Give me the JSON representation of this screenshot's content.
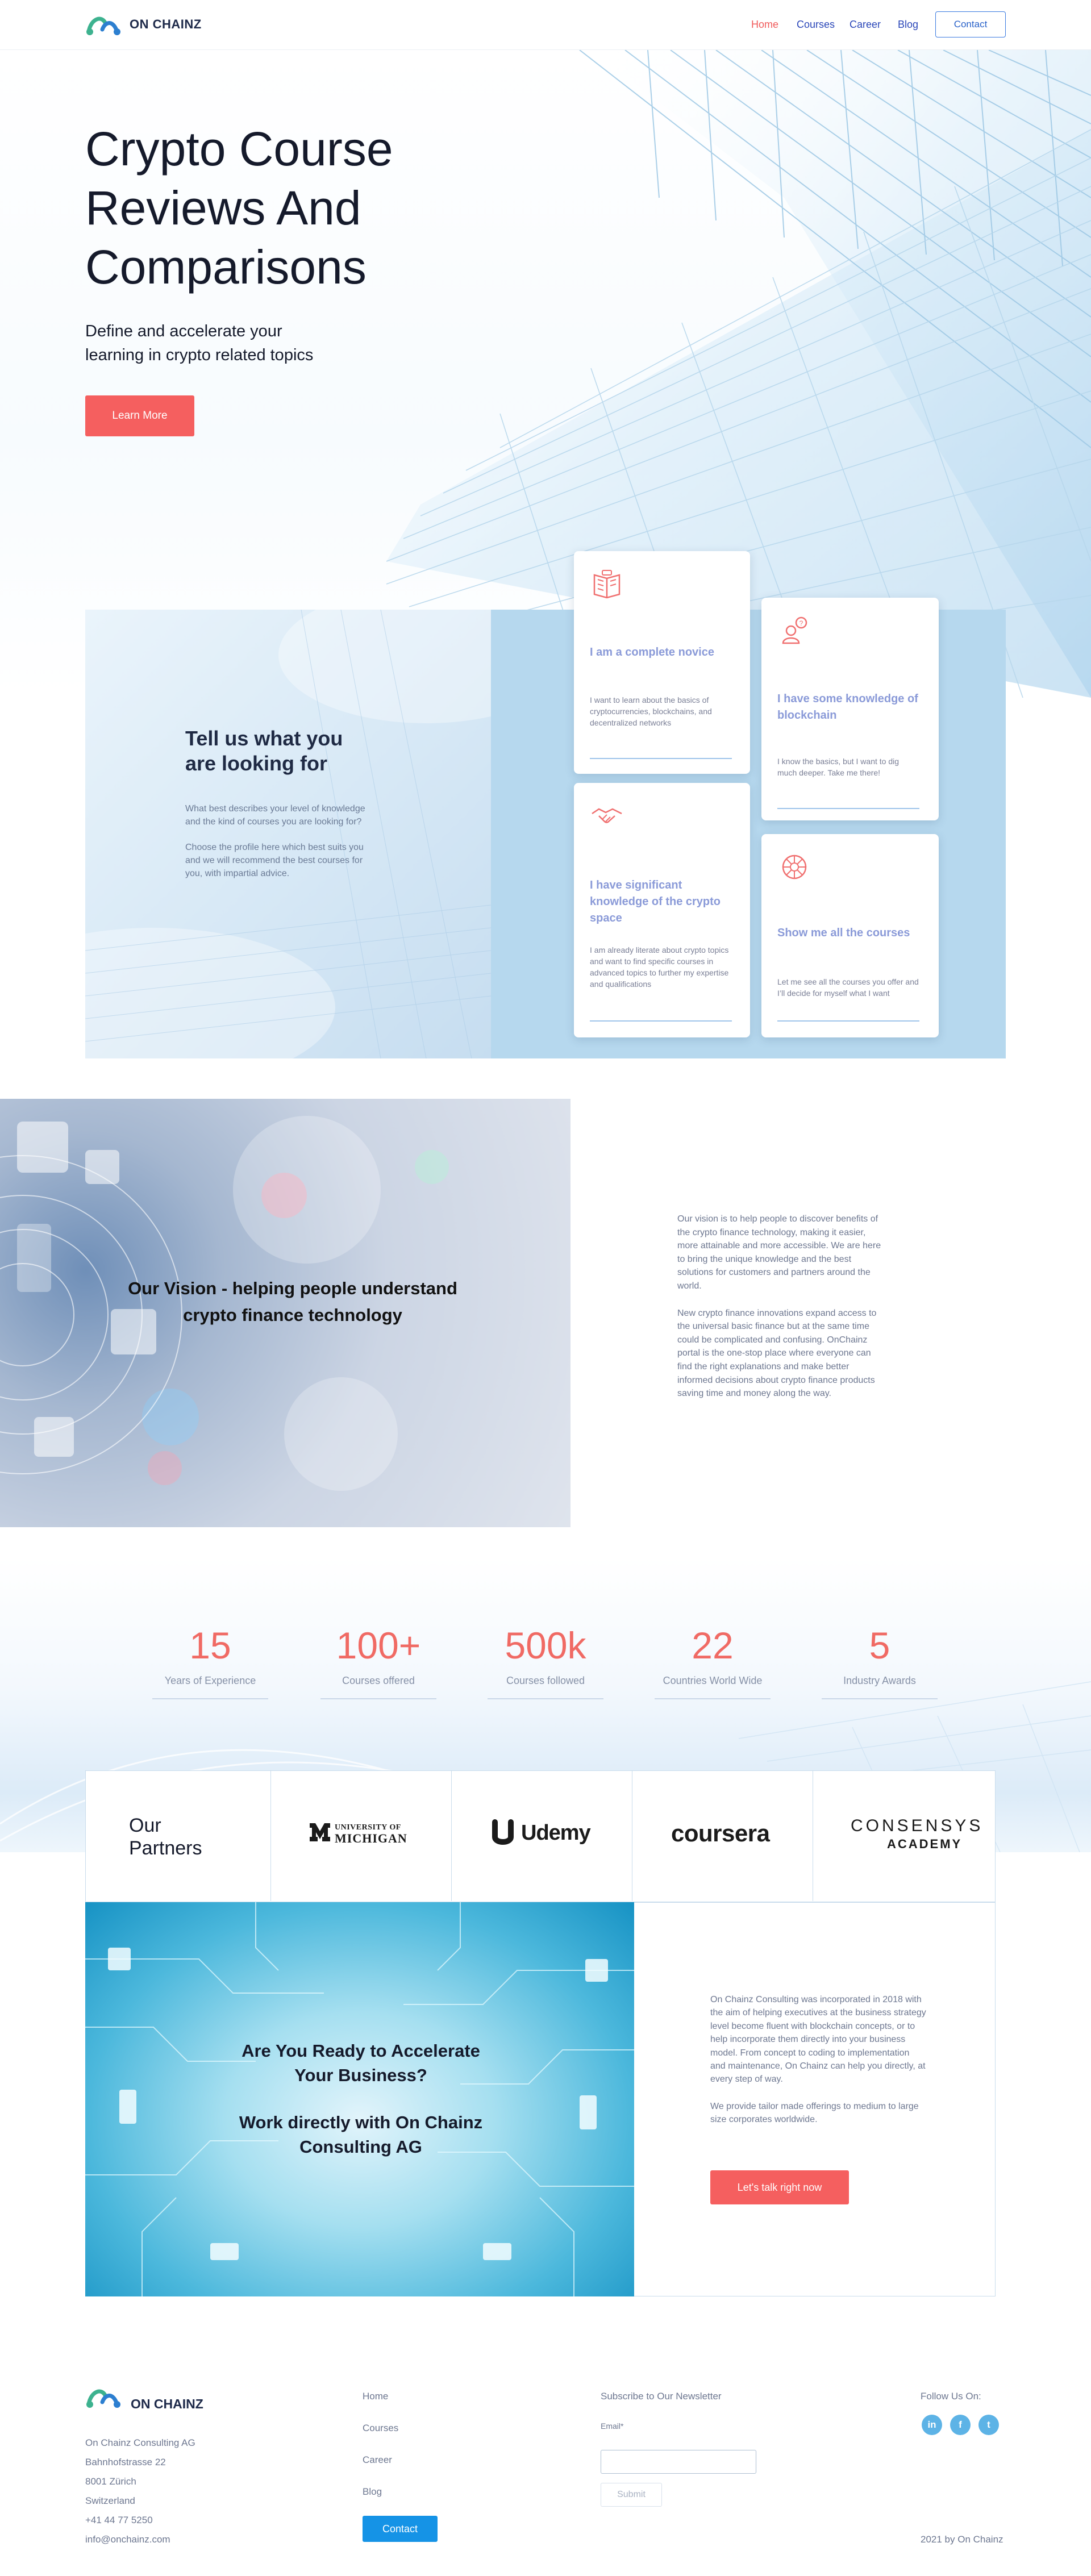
{
  "nav": {
    "brand": "ON CHAINZ",
    "links": [
      "Home",
      "Courses",
      "Career",
      "Blog"
    ],
    "contact": "Contact"
  },
  "hero": {
    "title_lines": [
      "Crypto Course",
      "Reviews And",
      "Comparisons"
    ],
    "subtitle_lines": [
      "Define and accelerate your",
      "learning in crypto related topics"
    ],
    "button": "Learn More"
  },
  "profiles": {
    "title_lines": [
      "Tell us what you",
      "are looking for"
    ],
    "p1": "What best describes your level of knowledge and the kind of courses you are looking for?",
    "p2": "Choose the profile here which best suits you and we will recommend the best courses for you, with impartial advice.",
    "cards": [
      {
        "icon": "book-icon",
        "title": "I am a complete novice",
        "text": "I want to learn about the basics of cryptocurrencies, blockchains, and decentralized networks"
      },
      {
        "icon": "person-question-icon",
        "title": "I have some knowledge of blockchain",
        "text": "I know the basics, but I want to dig much deeper. Take me there!"
      },
      {
        "icon": "handshake-icon",
        "title": "I have significant knowledge of the crypto space",
        "text": "I am already literate about crypto topics and want to find specific courses in advanced topics to further my expertise and qualifications"
      },
      {
        "icon": "network-icon",
        "title": "Show me all the courses",
        "text": "Let me see all the courses you offer and I’ll decide for myself what I want"
      }
    ]
  },
  "vision": {
    "title_lines": [
      "Our Vision - helping people understand",
      "crypto finance technology"
    ],
    "p1": "Our vision is to help people to discover benefits of the crypto finance technology, making it easier, more attainable and more accessible. We are here to bring the unique knowledge and the best solutions for customers and partners around the world.",
    "p2": "New crypto finance innovations expand access to the universal basic finance but at the same time could be complicated and confusing. OnChainz portal is the one-stop place where everyone can find the right explanations and make better informed decisions about crypto finance products saving time and money along the way."
  },
  "stats": [
    {
      "value": "15",
      "label": "Years of Experience"
    },
    {
      "value": "100+",
      "label": "Courses offered"
    },
    {
      "value": "500k",
      "label": "Courses followed"
    },
    {
      "value": "22",
      "label": "Countries World Wide"
    },
    {
      "value": "5",
      "label": "Industry Awards"
    }
  ],
  "partners": {
    "title_lines": [
      "Our",
      "Partners"
    ],
    "logos": [
      {
        "top": "UNIVERSITY OF",
        "bottom": "MICHIGAN"
      },
      {
        "name": "Udemy"
      },
      {
        "name": "coursera"
      },
      {
        "top": "CONSENSYS",
        "bottom": "ACADEMY"
      }
    ]
  },
  "consult": {
    "title_lines": [
      "Are You Ready to Accelerate",
      "Your Business?"
    ],
    "title2_lines": [
      "Work directly with On Chainz",
      "Consulting AG"
    ],
    "p1": "On Chainz Consulting was incorporated in 2018 with the aim of helping executives at the business strategy level become fluent with blockchain concepts, or to help incorporate them directly into your business model. From concept to coding to implementation and maintenance, On Chainz can help you directly, at every step of way.",
    "p2": "We provide tailor made offerings to medium to large size corporates worldwide.",
    "button": "Let's talk right now"
  },
  "footer": {
    "brand": "ON CHAINZ",
    "address": [
      "On Chainz Consulting AG",
      "Bahnhofstrasse 22",
      "8001 Zürich",
      "Switzerland",
      "+41 44 77 5250",
      "info@onchainz.com"
    ],
    "links": [
      "Home",
      "Courses",
      "Career",
      "Blog"
    ],
    "contact": "Contact",
    "newsletter_title": "Subscribe to Our Newsletter",
    "email_label": "Email*",
    "email_value": "",
    "submit": "Submit",
    "follow_title": "Follow Us On:",
    "social": [
      {
        "icon": "linkedin-icon",
        "glyph": "in"
      },
      {
        "icon": "facebook-icon",
        "glyph": "f"
      },
      {
        "icon": "twitter-icon",
        "glyph": "t"
      }
    ],
    "copyright": "2021 by On Chainz"
  },
  "colors": {
    "accent": "#f55f5f",
    "brand_blue": "#2a46b8",
    "card_title": "#8a9ad8",
    "stat_number": "#f06a64",
    "panel_blue": "#b6d8ee"
  }
}
